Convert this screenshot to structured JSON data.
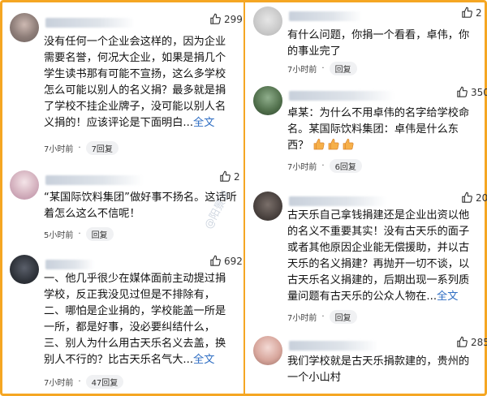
{
  "watermark": "@阳景说",
  "comments_left": [
    {
      "likes": "299",
      "lines": [
        "没有任何一个企业会这样的，因为企业",
        "需要名誉，何况大企业，如果是捐几个",
        "学生读书那有可能不宣扬，这么多学校",
        "怎么可能以别人的名义捐？最多就是捐",
        "了学校不挂企业牌子，没可能以别人名"
      ],
      "last_line": "义捐的！应该评论是下面明白...",
      "more": "全文",
      "time": "7小时前",
      "dot": "·",
      "replies": "7回复"
    },
    {
      "likes": "2",
      "lines": [
        "“某国际饮料集团”做好事不扬名。这话听"
      ],
      "last_line": "着怎么这么不信呢！",
      "more": "",
      "time": "5小时前",
      "dot": "·",
      "replies": "回复"
    },
    {
      "likes": "692",
      "lines": [
        "一、他几乎很少在媒体面前主动提过捐",
        "学校，反正我没见过但是不排除有，",
        "二、哪怕是企业捐的，学校能盖一所是",
        "一所，都是好事，没必要纠结什么，",
        "三、别人为什么用古天乐名义去盖，换"
      ],
      "last_line": "别人不行的？比古天乐名气大...",
      "more": "全文",
      "time": "7小时前",
      "dot": "·",
      "replies": "47回复"
    }
  ],
  "comments_right": [
    {
      "likes": "2",
      "lines": [
        "有什么问题，你捐一个看看，卓伟，你"
      ],
      "last_line": "的事业完了",
      "more": "",
      "time": "7小时前",
      "dot": "·",
      "replies": "回复"
    },
    {
      "likes": "350",
      "lines": [
        "卓某：为什么不用卓伟的名字给学校命",
        "名。某国际饮料集团：卓伟是什么东"
      ],
      "last_line": "西？",
      "emoji_count": 3,
      "more": "",
      "time": "7小时前",
      "dot": "·",
      "replies": "6回复"
    },
    {
      "likes": "20",
      "lines": [
        "古天乐自己拿钱捐建还是企业出资以他",
        "的名义不重要其实！没有古天乐的面子",
        "或者其他原因企业能无偿援助，并以古",
        "天乐的名义捐建？再抛开一切不谈，以",
        "古天乐名义捐建的，后期出现一系列质"
      ],
      "last_line": "量问题有古天乐的公众人物在...",
      "more": "全文",
      "time": "7小时前",
      "dot": "·",
      "replies": "回复"
    },
    {
      "likes": "285",
      "lines": [
        "我们学校就是古天乐捐款建的，贵州的"
      ],
      "last_line": "一个小山村",
      "more": "",
      "time": "",
      "dot": "",
      "replies": ""
    }
  ]
}
